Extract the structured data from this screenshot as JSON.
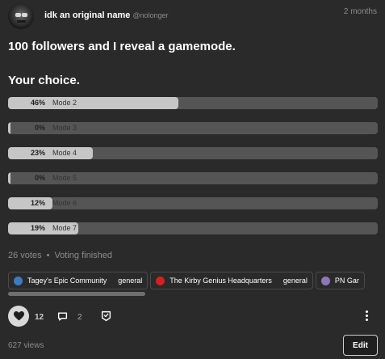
{
  "post": {
    "author": "idk an original name",
    "handle": "@nolonger",
    "time": "2 months",
    "title": "100 followers and I reveal a gamemode.",
    "subtitle": "Your choice."
  },
  "poll": {
    "options": [
      {
        "pct_label": "46%",
        "label": "Mode 2",
        "fraction": 0.46
      },
      {
        "pct_label": "0%",
        "label": "Mode 3",
        "fraction": 0.0
      },
      {
        "pct_label": "23%",
        "label": "Mode 4",
        "fraction": 0.23
      },
      {
        "pct_label": "0%",
        "label": "Mode 5",
        "fraction": 0.0
      },
      {
        "pct_label": "12%",
        "label": "Mode 6",
        "fraction": 0.12
      },
      {
        "pct_label": "19%",
        "label": "Mode 7",
        "fraction": 0.19
      }
    ],
    "votes": "26 votes",
    "status": "Voting finished"
  },
  "tags": [
    {
      "name": "Tagey's Epic Community",
      "category": "general",
      "color": "#3d7bbf"
    },
    {
      "name": "The Kirby Genius Headquarters",
      "category": "general",
      "color": "#d42020"
    },
    {
      "name": "PN Gar",
      "category": "",
      "color": "#8a78b8"
    }
  ],
  "actions": {
    "likes": "12",
    "comments": "2",
    "views": "627 views",
    "edit_label": "Edit"
  },
  "icons": {
    "like": "heart-icon",
    "comment": "comment-icon",
    "share": "share-icon",
    "more": "more-vertical-icon"
  }
}
